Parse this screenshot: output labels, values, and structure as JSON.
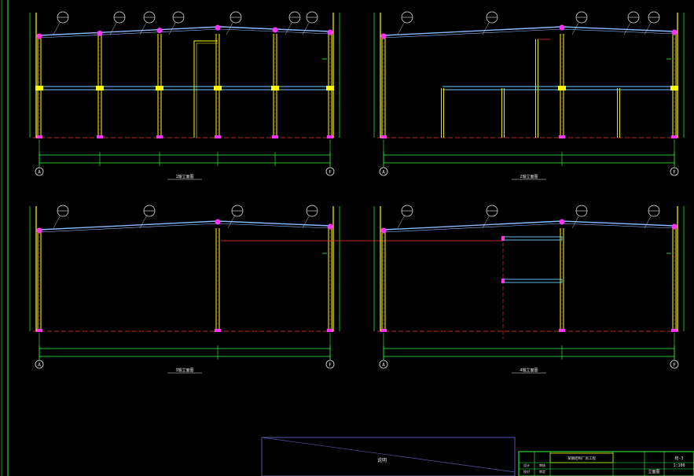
{
  "drawing": {
    "background": "#000000",
    "colors": {
      "column": "#ffff00",
      "beam": "#66ccff",
      "rafter": "#88bbff",
      "dim": "#33ff33",
      "axis": "#ff3333",
      "node": "#ff33ff",
      "text": "#e8e8e8",
      "border": "#33ff33",
      "block": "#5555aa"
    },
    "panels": [
      {
        "id": "elevation-1",
        "axis_start": "A",
        "axis_end": "F",
        "caption": "1轴立面图"
      },
      {
        "id": "elevation-2",
        "axis_start": "A",
        "axis_end": "F",
        "caption": "2轴立面图"
      },
      {
        "id": "elevation-3",
        "axis_start": "A",
        "axis_end": "F",
        "caption": "3轴立面图"
      },
      {
        "id": "elevation-4",
        "axis_start": "A",
        "axis_end": "F",
        "caption": "4轴立面图"
      }
    ],
    "bottom_block_label": "说明",
    "title_block": {
      "project": "某钢结构厂房工程",
      "sheet_title": "立面图",
      "rows": [
        "设计",
        "校对",
        "审核",
        "审定"
      ],
      "sheet_no": "结-3",
      "scale": "1:100"
    }
  }
}
